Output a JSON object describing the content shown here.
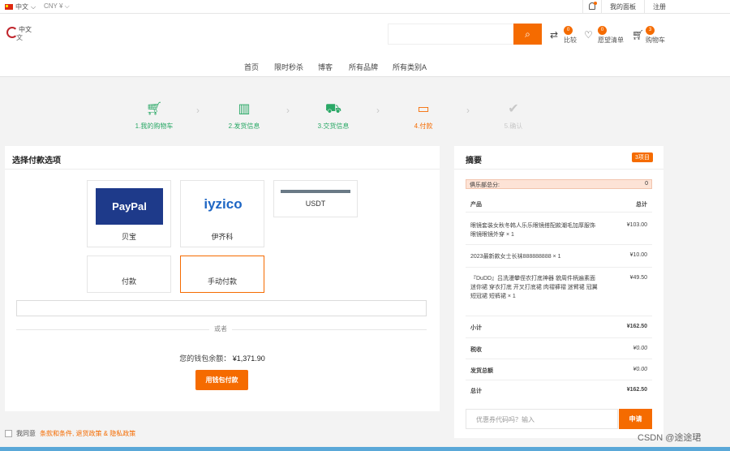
{
  "topbar": {
    "lang": "中文",
    "currency": "CNY ¥",
    "dashboard": "我的面板",
    "register": "注册"
  },
  "header": {
    "logo_line1": "中文",
    "logo_line2": "文",
    "compare": {
      "count": "0",
      "label": "比较"
    },
    "wishlist": {
      "count": "0",
      "label": "愿望清单"
    },
    "cart": {
      "count": "3",
      "label": "购物车"
    }
  },
  "nav": [
    "首页",
    "限时秒杀",
    "博客",
    "所有品牌",
    "所有类别A"
  ],
  "steps": [
    {
      "label": "1.我的购物车",
      "state": "done",
      "icon": "cart-icon"
    },
    {
      "label": "2.发货信息",
      "state": "done",
      "icon": "map-icon"
    },
    {
      "label": "3.交货信息",
      "state": "done",
      "icon": "truck-icon"
    },
    {
      "label": "4.付款",
      "state": "active",
      "icon": "card-icon"
    },
    {
      "label": "5.确认",
      "state": "todo",
      "icon": "check-circle-icon"
    }
  ],
  "payment": {
    "title": "选择付款选项",
    "methods": [
      {
        "name": "paypal",
        "label": "贝宝",
        "logo_text": "PayPal"
      },
      {
        "name": "iyzico",
        "label": "伊齐科",
        "logo_text": "iyzico"
      },
      {
        "name": "usdt",
        "label": "USDT"
      },
      {
        "name": "payment",
        "label": "付款"
      },
      {
        "name": "manual",
        "label": "手动付款",
        "selected": true
      }
    ],
    "or": "或者",
    "balance_label": "您的钱包余额：",
    "balance_value": "¥1,371.90",
    "wallet_button": "用钱包付款"
  },
  "agree": {
    "prefix": "我同意",
    "links": "条款和条件, 退货政策 & 隐私政策"
  },
  "summary": {
    "title": "摘要",
    "count_badge": "3项目",
    "points_label": "俱乐部总分:",
    "points_value": "0",
    "col_product": "产品",
    "col_total": "总计",
    "items": [
      {
        "name": "眼镜套装女秋冬韩人乐乐眼镜搭配款潮毛加厚服饰眼镜眼镜外穿 × 1",
        "price": "¥103.00"
      },
      {
        "name": "2023最新款女士长袜888888888 × 1",
        "price": "¥10.00"
      },
      {
        "name": "『DuDD』吕洗漫攀侄农打底神器 貌周件柄遍素面迷你裙 穿衣打底 开叉打底裙 肉褶褲褶 迷臂裙 冠翼 短冠裙 短裤裙 × 1",
        "price": "¥49.50"
      }
    ],
    "subtotal_label": "小计",
    "subtotal": "¥162.50",
    "tax_label": "税收",
    "tax": "¥0.00",
    "shipping_label": "发货总额",
    "shipping": "¥0.00",
    "total_label": "总计",
    "total": "¥162.50",
    "coupon_placeholder": "优惠券代码吗？输入",
    "apply_label": "申请"
  },
  "watermark": "CSDN @途途珺",
  "colors": {
    "accent": "#f56b00",
    "done": "#2aa866",
    "todo": "#c8c8c8"
  }
}
